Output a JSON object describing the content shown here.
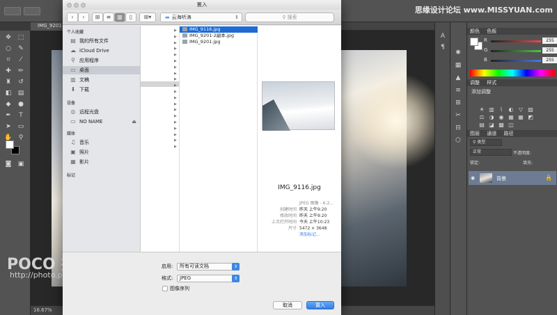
{
  "photoshop": {
    "doc_tab": "IMG_9201",
    "zoom": "16.67%",
    "watermark_top_right": "思缘设计论坛 www.MISSYUAN.com",
    "watermark_logo": "POCO 摄影专题",
    "watermark_url": "http://photo.poco.cn/",
    "color_panel": {
      "tabs": [
        "颜色",
        "色板"
      ],
      "rows": [
        {
          "label": "R",
          "value": "255",
          "color": "#f04848"
        },
        {
          "label": "G",
          "value": "255",
          "color": "#48c848"
        },
        {
          "label": "B",
          "value": "255",
          "color": "#4878f0"
        }
      ]
    },
    "adjust_panel": {
      "tabs": [
        "调整",
        "样式"
      ],
      "title": "添加调整",
      "icons": [
        "brightness-icon",
        "levels-icon",
        "curves-icon",
        "exposure-icon",
        "vibrance-icon",
        "hue-icon",
        "balance-icon",
        "bw-icon",
        "photo-filter-icon",
        "mixer-icon",
        "lookup-icon",
        "invert-icon",
        "posterize-icon",
        "threshold-icon",
        "gradient-map-icon",
        "selective-color-icon"
      ]
    },
    "layers_panel": {
      "tabs": [
        "图层",
        "通道",
        "路径"
      ],
      "filter": "类型",
      "blend": "正常",
      "opacity_label": "不透明度:",
      "lock_label": "锁定:",
      "fill_label": "填充:",
      "layer_name": "背景"
    }
  },
  "dialog": {
    "title": "置入",
    "location": "云海听涛",
    "search_placeholder": "搜索",
    "sidebar": {
      "favorites_header": "个人收藏",
      "favorites": [
        {
          "label": "我的所有文件",
          "icon": "all-files-icon",
          "glyph": "▤"
        },
        {
          "label": "iCloud Drive",
          "icon": "cloud-icon",
          "glyph": "☁"
        },
        {
          "label": "应用程序",
          "icon": "apps-icon",
          "glyph": "⚲"
        },
        {
          "label": "桌面",
          "icon": "desktop-icon",
          "glyph": "▭"
        },
        {
          "label": "文稿",
          "icon": "documents-icon",
          "glyph": "▥"
        },
        {
          "label": "下载",
          "icon": "download-icon",
          "glyph": "⬇"
        }
      ],
      "devices_header": "设备",
      "devices": [
        {
          "label": "远程光盘",
          "icon": "disc-icon",
          "glyph": "◎"
        },
        {
          "label": "NO NAME",
          "icon": "drive-icon",
          "glyph": "▭"
        }
      ],
      "media_header": "媒体",
      "media": [
        {
          "label": "音乐",
          "icon": "music-icon",
          "glyph": "♫"
        },
        {
          "label": "照片",
          "icon": "photos-icon",
          "glyph": "▣"
        },
        {
          "label": "影片",
          "icon": "movie-icon",
          "glyph": "▦"
        }
      ],
      "tags_header": "标记"
    },
    "files": [
      "IMG_9116.jpg",
      "IMG_9201-2副本.jpg",
      "IMG_9201.jpg"
    ],
    "preview": {
      "name": "IMG_9116.jpg",
      "info": [
        {
          "k": "",
          "v": "JPEG 图像 - 6.2..."
        },
        {
          "k": "创建时间",
          "v": "昨天 上午9:20"
        },
        {
          "k": "修改时间",
          "v": "昨天 上午9:20"
        },
        {
          "k": "上次打开时间",
          "v": "今天 上午10:23"
        },
        {
          "k": "尺寸",
          "v": "5472 × 3648"
        }
      ],
      "add_tag": "添加标记..."
    },
    "enable_label": "启用:",
    "enable_value": "所有可读文档",
    "format_label": "格式:",
    "format_value": "JPEG",
    "sequence_label": "图像序列",
    "cancel_label": "取消",
    "place_label": "置入"
  }
}
